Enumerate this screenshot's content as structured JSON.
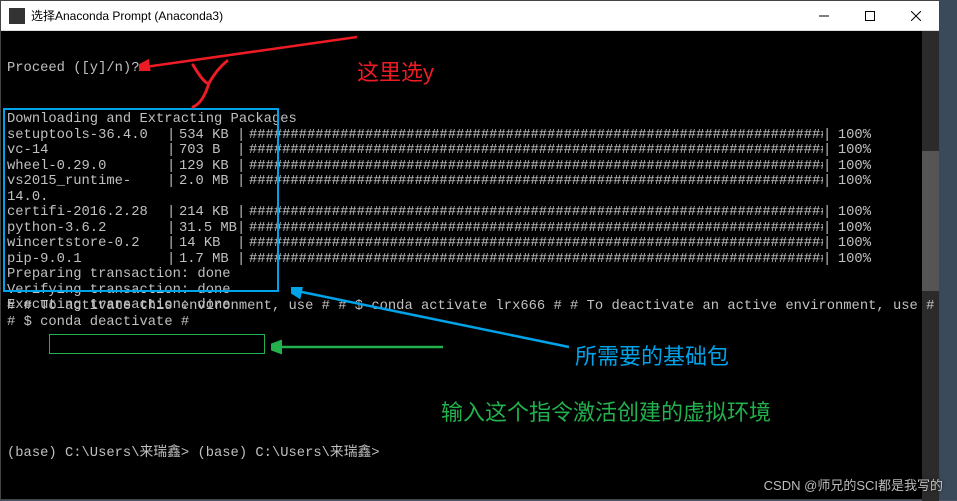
{
  "window": {
    "title": "选择Anaconda Prompt (Anaconda3)"
  },
  "terminal": {
    "proceed": "Proceed ([y]/n)?",
    "downloading_header": "Downloading and Extracting Packages",
    "packages": [
      {
        "name": "setuptools-36.4.0",
        "size": "534 KB",
        "pct": "100%"
      },
      {
        "name": "vc-14",
        "size": "703 B",
        "pct": "100%"
      },
      {
        "name": "wheel-0.29.0",
        "size": "129 KB",
        "pct": "100%"
      },
      {
        "name": "vs2015_runtime-14.0.",
        "size": "2.0 MB",
        "pct": "100%"
      },
      {
        "name": "certifi-2016.2.28",
        "size": "214 KB",
        "pct": "100%"
      },
      {
        "name": "python-3.6.2",
        "size": "31.5 MB",
        "pct": "100%"
      },
      {
        "name": "wincertstore-0.2",
        "size": "14 KB",
        "pct": "100%"
      },
      {
        "name": "pip-9.0.1",
        "size": "1.7 MB",
        "pct": "100%"
      }
    ],
    "preparing": "Preparing transaction: done",
    "verifying": "Verifying transaction: done",
    "executing": "Executing transaction: done",
    "hash": "#",
    "activate_hint": "# To activate this environment, use",
    "activate_cmd": "$ conda activate lrx666",
    "deactivate_hint": "# To deactivate an active environment, use",
    "deactivate_cmd": "$ conda deactivate",
    "prompt": "(base) C:\\Users\\来瑞鑫>"
  },
  "annotations": {
    "red_text": "这里选y",
    "blue_text": "所需要的基础包",
    "green_text": "输入这个指令激活创建的虚拟环境"
  },
  "watermark": "CSDN @师兄的SCI都是我写的"
}
